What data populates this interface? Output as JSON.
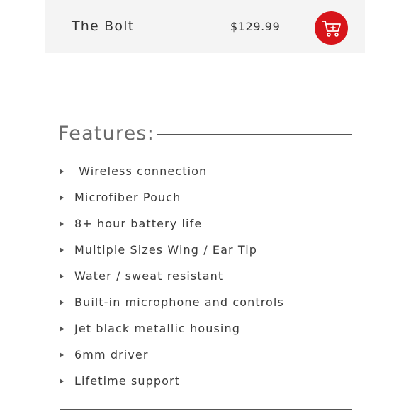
{
  "product": {
    "name": "The Bolt",
    "price": "$129.99",
    "cart_icon": "add-to-cart-icon",
    "cart_color": "#d7141a",
    "bar_color": "#f4f4f4"
  },
  "features": {
    "title": "Features:",
    "items": [
      " Wireless connection",
      "Microfiber Pouch",
      "8+ hour battery life",
      "Multiple Sizes Wing / Ear Tip",
      "Water / sweat resistant",
      "Built-in microphone and controls",
      "Jet black metallic housing",
      "6mm driver",
      "Lifetime support"
    ],
    "bullet_icon": "triangle-bullet-icon"
  }
}
